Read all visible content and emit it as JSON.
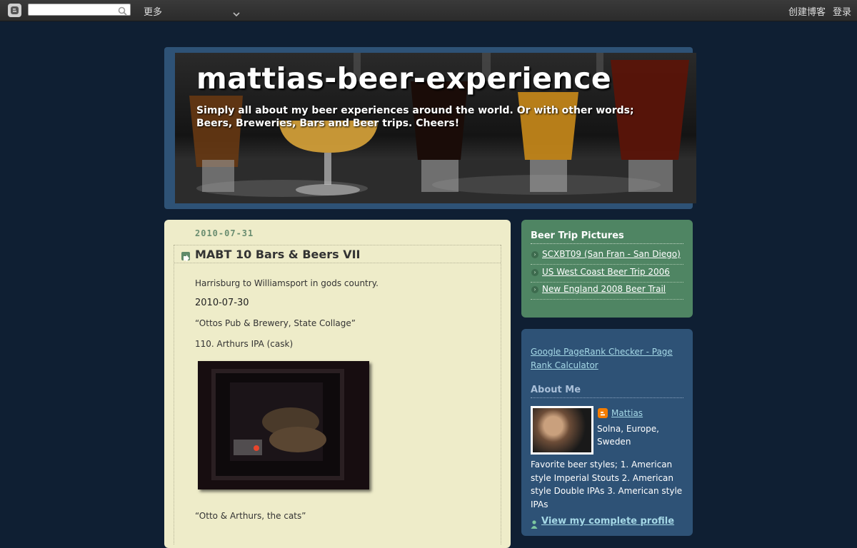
{
  "navbar": {
    "search_placeholder": "",
    "more_label": "更多",
    "create_blog_label": "创建博客",
    "login_label": "登录"
  },
  "header": {
    "title": "mattias-beer-experience",
    "description": "Simply all about my beer experiences around the world. Or with other words; Beers, Breweries, Bars and Beer trips. Cheers!"
  },
  "post": {
    "date": "2010-07-31",
    "title": "MABT 10 Bars & Beers VII",
    "intro": "Harrisburg to Williamsport in gods country.",
    "subdate": "2010-07-30",
    "venue": "“Ottos Pub & Brewery, State Collage”",
    "beer": "110. Arthurs IPA (cask)",
    "caption": "“Otto & Arthurs, the cats”"
  },
  "sidebar": {
    "trip_pictures": {
      "heading": "Beer Trip Pictures",
      "links": [
        {
          "label": "SCXBT09 (San Fran - San Diego)"
        },
        {
          "label": "US West Coast Beer Trip 2006"
        },
        {
          "label": "New England 2008 Beer Trail"
        }
      ]
    },
    "pagerank_link": "Google PageRank Checker - Page Rank Calculator",
    "about": {
      "heading": "About Me",
      "name": "Mattias",
      "location": "Solna, Europe, Sweden",
      "description": "Favorite beer styles; 1. American style Imperial Stouts 2. American style Double IPAs 3. American style IPAs",
      "view_profile": "View my complete profile"
    }
  },
  "colors": {
    "page_bg": "#0f1f33",
    "header_frame": "#2e5276",
    "post_bg": "#eeecc9",
    "widget_green": "#4f8563",
    "widget_blue": "#2e5276",
    "link_light": "#a5d8e6"
  }
}
